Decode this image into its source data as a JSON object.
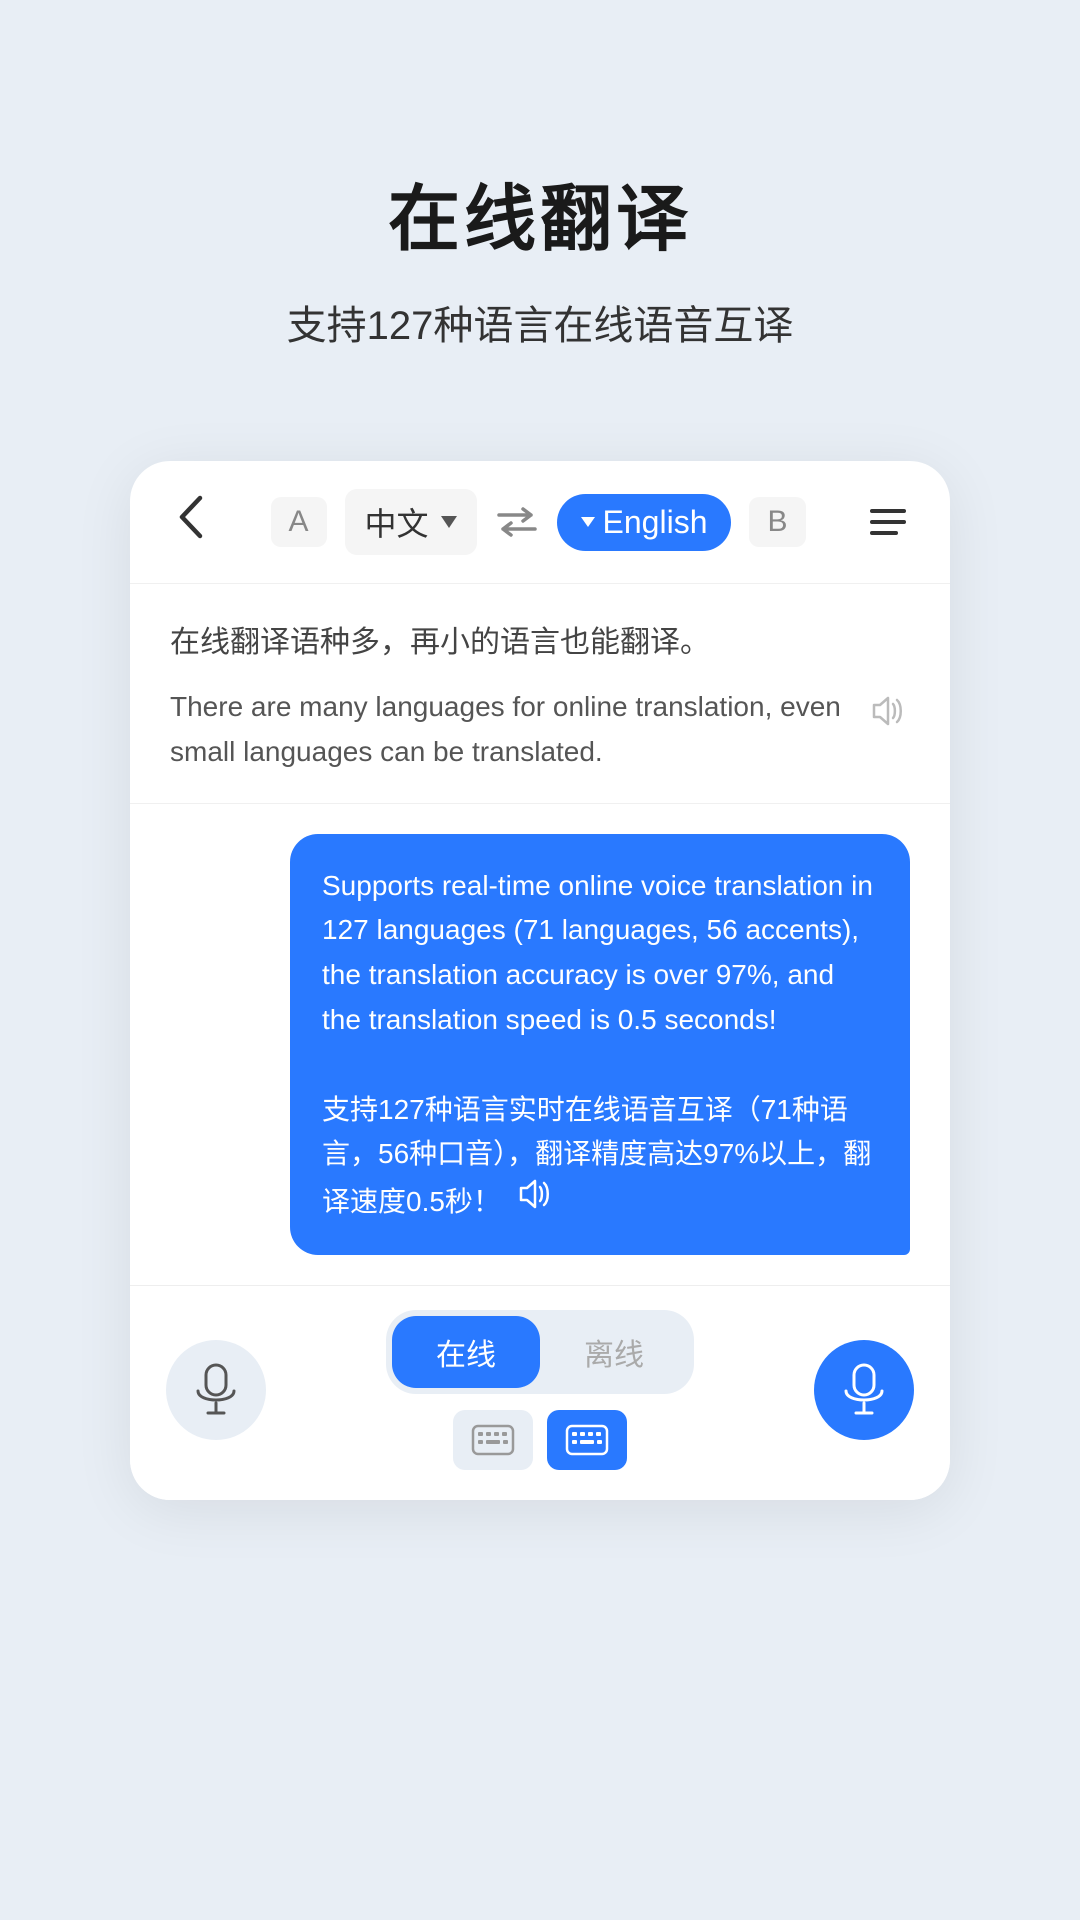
{
  "header": {
    "title": "在线翻译",
    "subtitle": "支持127种语言在线语音互译"
  },
  "topbar": {
    "back_label": "<",
    "label_a": "A",
    "lang_chinese": "中文",
    "swap_icon": "swap",
    "lang_english": "English",
    "label_b": "B",
    "menu_icon": "menu"
  },
  "translation": {
    "source_text": "在线翻译语种多，再小的语言也能翻译。",
    "translated_text": "There are many languages for online translation, even small languages can be translated.",
    "speaker_icon": "volume-icon"
  },
  "chat": {
    "bubble_english": "Supports real-time online voice translation in 127 languages (71 languages, 56 accents), the translation accuracy is over 97%, and the translation speed is 0.5 seconds!",
    "bubble_chinese": "支持127种语言实时在线语音互译（71种语言，56种口音），翻译精度高达97%以上，翻译速度0.5秒！",
    "speaker_icon": "volume-white-icon"
  },
  "bottombar": {
    "left_mic_label": "mic-left",
    "mode_online": "在线",
    "mode_offline": "离线",
    "keyboard_gray": "keyboard-gray",
    "keyboard_blue": "keyboard-blue",
    "right_mic_label": "mic-right"
  },
  "colors": {
    "accent": "#2979ff",
    "background": "#e8eef5",
    "card_bg": "#ffffff",
    "text_dark": "#1a1a1a",
    "text_mid": "#444",
    "text_light": "#888"
  }
}
